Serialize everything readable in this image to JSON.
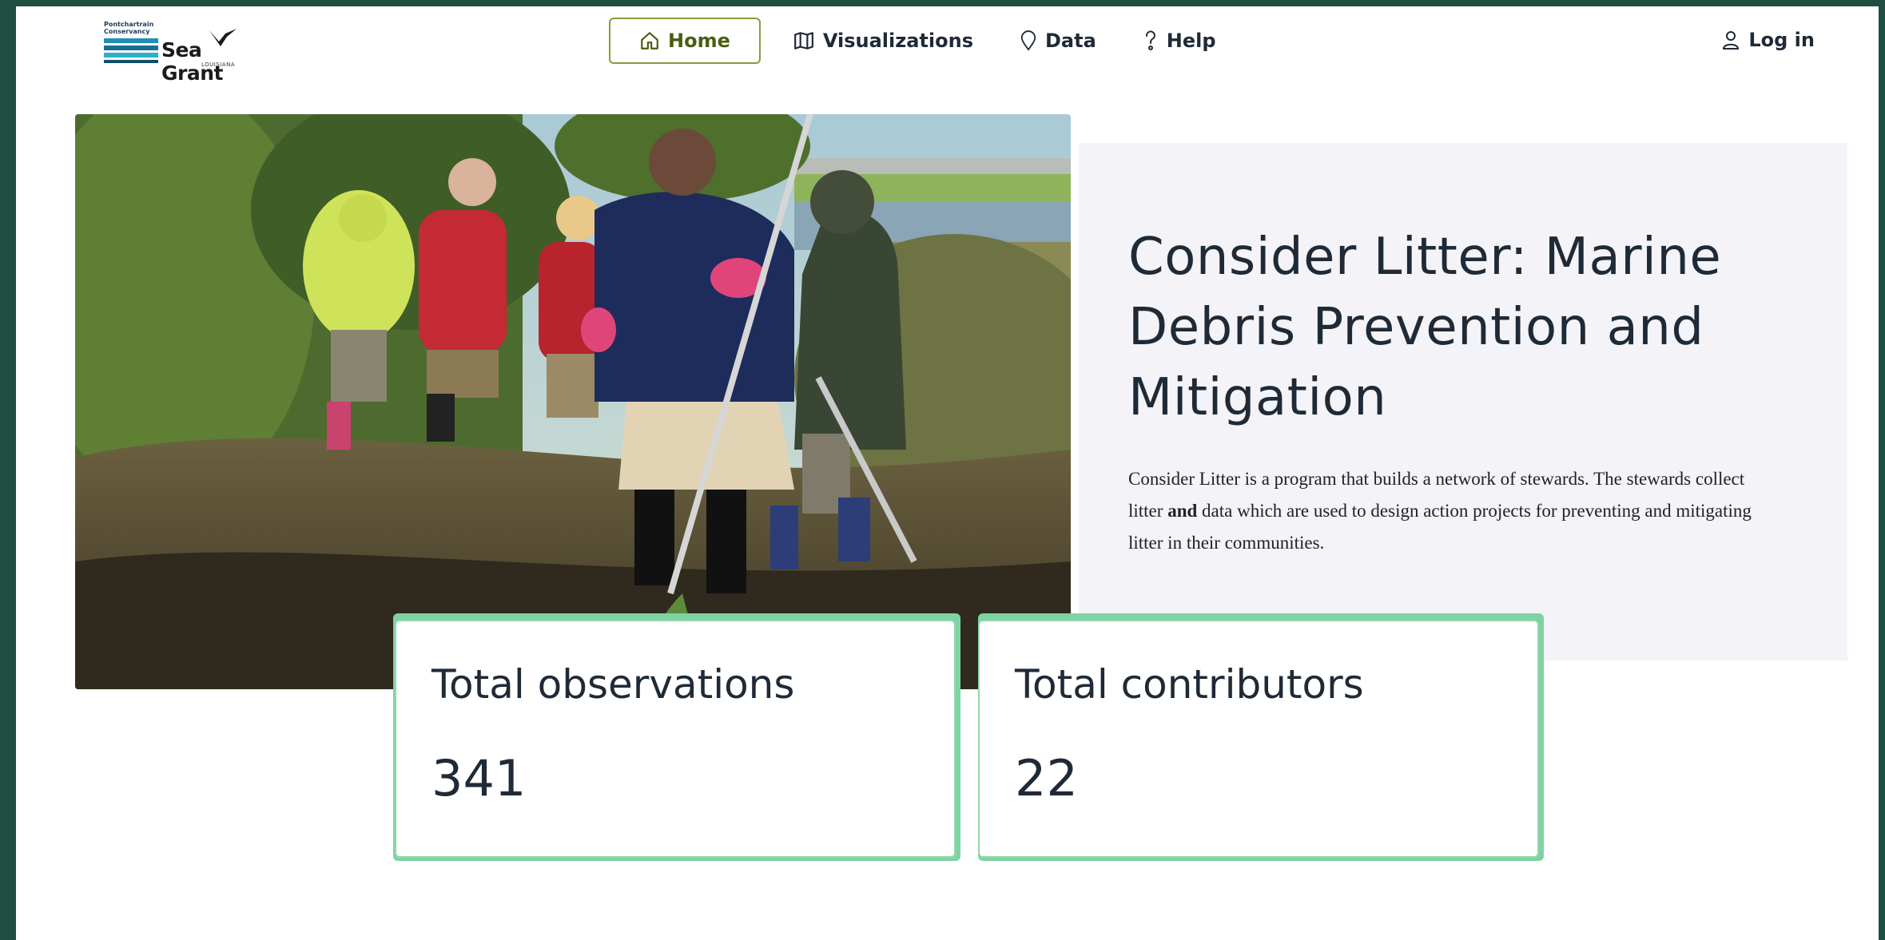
{
  "logo": {
    "org": "Pontchartrain Conservancy",
    "brand": "Sea Grant",
    "state": "LOUISIANA"
  },
  "nav": {
    "items": [
      {
        "label": "Home",
        "icon": "home-icon",
        "active": true
      },
      {
        "label": "Visualizations",
        "icon": "map-icon",
        "active": false
      },
      {
        "label": "Data",
        "icon": "map-pin-icon",
        "active": false
      },
      {
        "label": "Help",
        "icon": "help-icon",
        "active": false
      }
    ],
    "login_label": "Log in"
  },
  "hero": {
    "title": "Consider Litter: Marine Debris Prevention and Mitigation",
    "description_part1": "Consider Litter is a program that builds a network of stewards. The stewards collect litter ",
    "description_bold": "and",
    "description_part2": " data which are used to design action projects for preventing and mitigating litter in their communities."
  },
  "stats": [
    {
      "label": "Total observations",
      "value": "341"
    },
    {
      "label": "Total contributors",
      "value": "22"
    }
  ],
  "colors": {
    "frame": "#1f4e42",
    "active_nav": "#4a5d12",
    "card_accent": "#7fd3a2",
    "panel": "#f3f3f8"
  }
}
